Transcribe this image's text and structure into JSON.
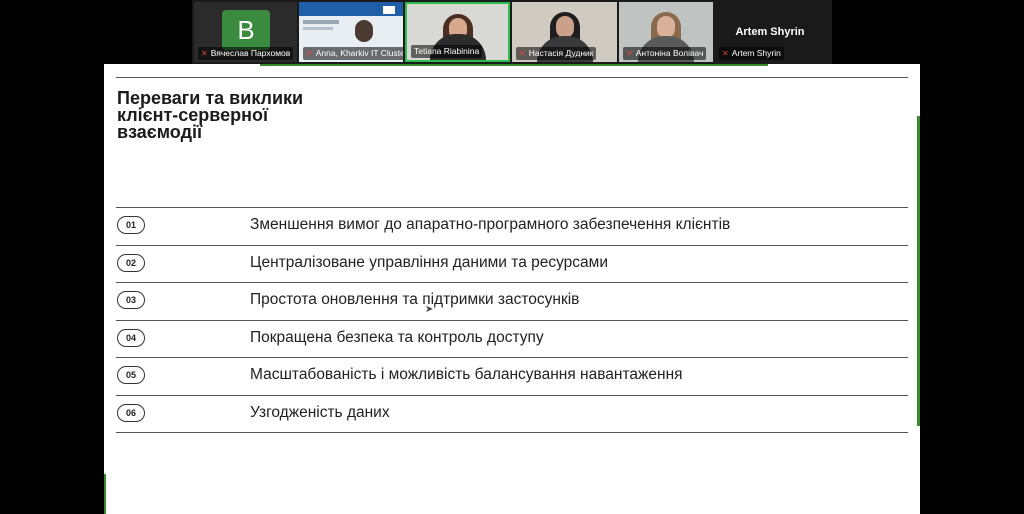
{
  "participants": [
    {
      "name": "Вячеслав Пархомов",
      "initial": "B",
      "muted": true,
      "type": "avatar"
    },
    {
      "name": "Anna, Kharkiv IT Cluster",
      "muted": true,
      "type": "video"
    },
    {
      "name": "Tetiana Riabinina",
      "muted": false,
      "type": "video",
      "active": true
    },
    {
      "name": "Настасія Дудник",
      "muted": true,
      "type": "video"
    },
    {
      "name": "Антоніна Волівач",
      "muted": true,
      "type": "video"
    },
    {
      "name": "Artem Shyrin",
      "display_name": "Artem Shyrin",
      "muted": true,
      "type": "name-only"
    }
  ],
  "slide": {
    "title_lines": [
      "Переваги та виклики",
      "клієнт-серверної",
      "взаємодії"
    ],
    "items": [
      {
        "num": "01",
        "text": "Зменшення вимог до апаратно-програмного забезпечення клієнтів"
      },
      {
        "num": "02",
        "text": "Централізоване управління даними та ресурсами"
      },
      {
        "num": "03",
        "text": "Простота оновлення та підтримки застосунків"
      },
      {
        "num": "04",
        "text": "Покращена безпека та контроль доступу"
      },
      {
        "num": "05",
        "text": "Масштабованість і можливість балансування навантаження"
      },
      {
        "num": "06",
        "text": "Узгодженість даних"
      }
    ]
  },
  "colors": {
    "accent_green": "#3c8a2e",
    "active_border": "#2dbd4e",
    "muted_icon": "#e5453a"
  }
}
